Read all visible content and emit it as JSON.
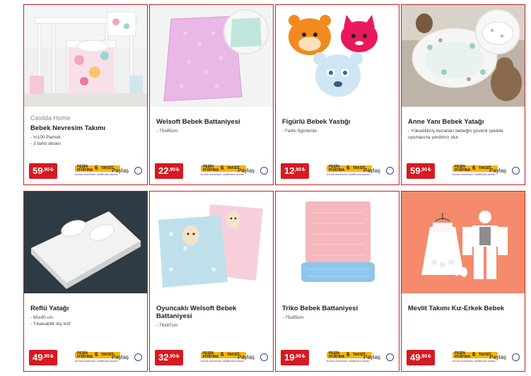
{
  "products": [
    {
      "brand": "Casilda Home",
      "title": "Bebek Nevresim Takımı",
      "features": [
        "- %100 Pamuk",
        "- 3 farklı desen"
      ],
      "price_int": "59",
      "price_dec": ",90",
      "currency": "₺",
      "image_icon": "baby-bedding-crib-image"
    },
    {
      "brand": "",
      "title": "Welsoft Bebek Battaniyesi",
      "features": [
        "- 75x85cm"
      ],
      "price_int": "22",
      "price_dec": ",90",
      "currency": "₺",
      "image_icon": "pink-blanket-image"
    },
    {
      "brand": "",
      "title": "Figürlü Bebek Yastığı",
      "features": [
        "- Farklı figürlerde"
      ],
      "price_int": "12",
      "price_dec": ",90",
      "currency": "₺",
      "image_icon": "animal-pillows-image"
    },
    {
      "brand": "",
      "title": "Anne Yanı Bebek Yatağı",
      "features": [
        "- Yükseltilmiş kenarları bebeğin güvenli şekilde uyumasına yardımcı olur"
      ],
      "price_int": "59",
      "price_dec": ",90",
      "currency": "₺",
      "image_icon": "baby-nest-bed-image"
    },
    {
      "brand": "",
      "title": "Reflü Yatağı",
      "features": [
        "- 65x40 cm",
        "- Yıkanabilir dış kılıf"
      ],
      "price_int": "49",
      "price_dec": ",90",
      "currency": "₺",
      "image_icon": "reflux-wedge-bed-image"
    },
    {
      "brand": "",
      "title": "Oyuncaklı Welsoft Bebek Battaniyesi",
      "features": [
        "- 76x87cm"
      ],
      "price_int": "32",
      "price_dec": ",90",
      "currency": "₺",
      "image_icon": "toy-blankets-image"
    },
    {
      "brand": "",
      "title": "Triko Bebek Battaniyesi",
      "features": [
        "- 75x85cm"
      ],
      "price_int": "19",
      "price_dec": ",90",
      "currency": "₺",
      "image_icon": "knit-blankets-image"
    },
    {
      "brand": "",
      "title": "Mevlit Takımı Kız-Erkek Bebek",
      "features": [],
      "price_int": "49",
      "price_dec": ",90",
      "currency": "₺",
      "image_icon": "mevlit-outfits-image"
    }
  ],
  "installment": {
    "left_label": "PEŞİN FİYATINA",
    "number": "6",
    "right_label": "TAKSİT",
    "cards": "bonus maximum cardfinans axess"
  },
  "share_label": "Paylaş",
  "colors": {
    "border": "#c9201f",
    "price_bg": "#d71920",
    "installment_bg": "#f7b500",
    "share_circle": "#2a4a8c"
  }
}
